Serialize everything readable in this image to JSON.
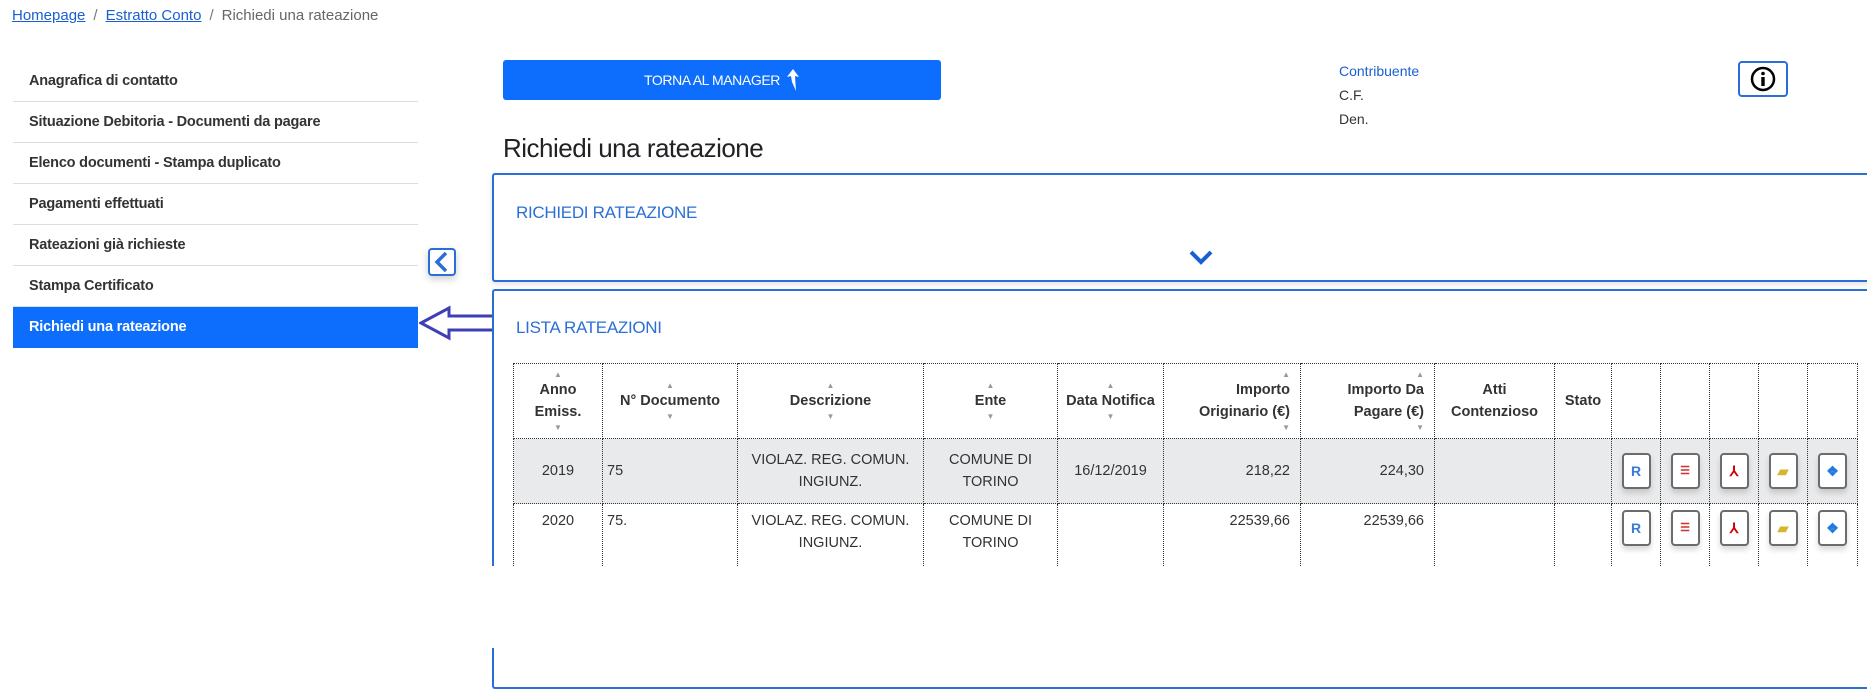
{
  "breadcrumb": {
    "items": [
      {
        "label": "Homepage"
      },
      {
        "label": "Estratto Conto"
      }
    ],
    "current": "Richiedi una rateazione",
    "separator": "/"
  },
  "sidebar": {
    "items": [
      {
        "label": "Anagrafica di contatto"
      },
      {
        "label": "Situazione Debitoria - Documenti da pagare"
      },
      {
        "label": "Elenco documenti - Stampa duplicato"
      },
      {
        "label": "Pagamenti effettuati"
      },
      {
        "label": "Rateazioni già richieste"
      },
      {
        "label": "Stampa Certificato"
      },
      {
        "label": "Richiedi una rateazione",
        "active": true
      }
    ]
  },
  "header": {
    "back_button": "TORNA AL MANAGER",
    "contribuente_label": "Contribuente",
    "cf_label": "C.F.",
    "den_label": "Den."
  },
  "page_title": "Richiedi una rateazione",
  "panels": {
    "request_title": "RICHIEDI RATEAZIONE",
    "list_title": "LISTA RATEAZIONI"
  },
  "table": {
    "headers": [
      "Anno Emiss.",
      "N° Documento",
      "Descrizione",
      "Ente",
      "Data Notifica",
      "Importo Originario (€)",
      "Importo Da Pagare (€)",
      "Atti Contenzioso",
      "Stato"
    ],
    "rows": [
      {
        "anno": "2019",
        "documento": "75",
        "descrizione": "VIOLAZ. REG. COMUN. INGIUNZ.",
        "ente": "COMUNE DI TORINO",
        "data": "16/12/2019",
        "originario": "218,22",
        "da_pagare": "224,30",
        "atti": "",
        "stato": ""
      },
      {
        "anno": "2020",
        "documento": "75.",
        "descrizione": "VIOLAZ. REG. COMUN. INGIUNZ.",
        "ente": "COMUNE DI TORINO",
        "data": "",
        "originario": "22539,66",
        "da_pagare": "22539,66",
        "atti": "",
        "stato": ""
      }
    ],
    "action_icons": [
      "cart-r-icon",
      "document-icon",
      "pdf-icon",
      "folder-icon",
      "handshake-icon"
    ]
  },
  "colors": {
    "primary": "#0d6efd",
    "accent": "#2b6fd6",
    "arrow": "#3f3fb5"
  }
}
